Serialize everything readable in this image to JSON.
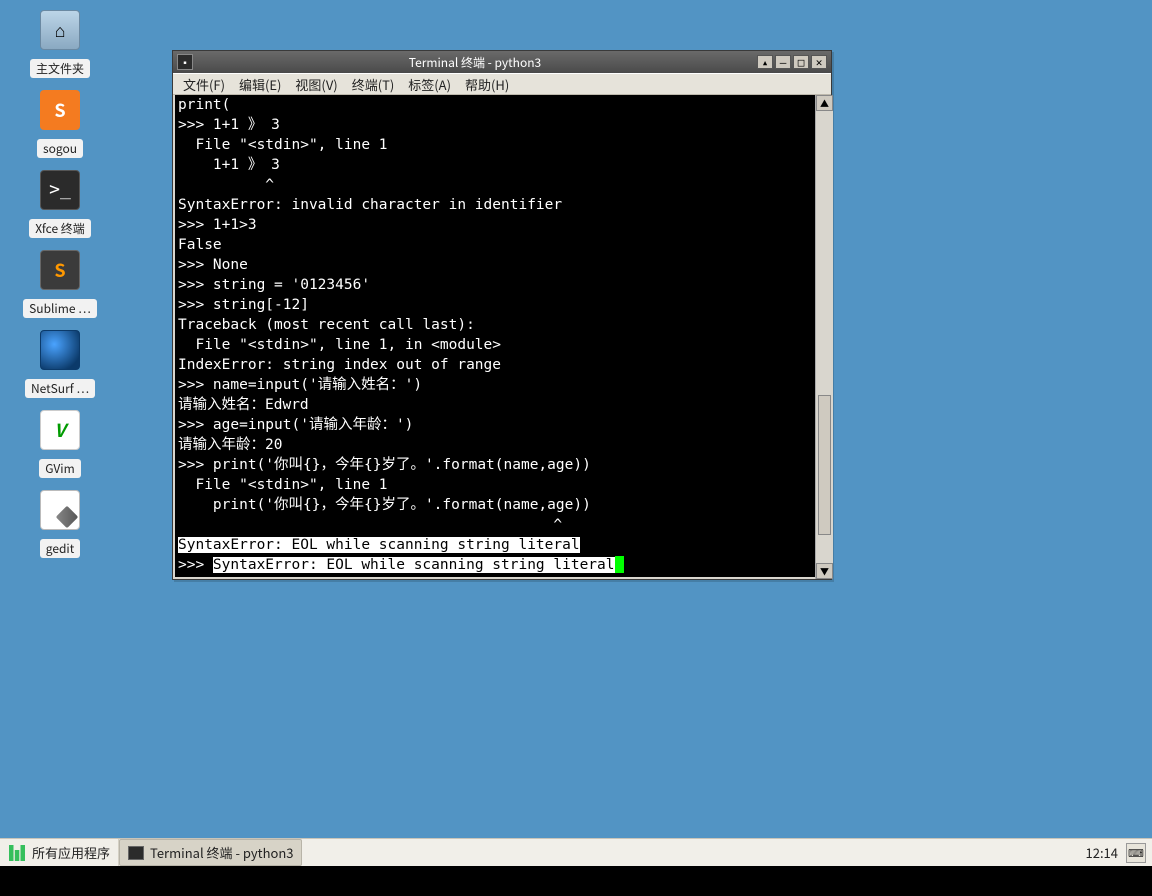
{
  "desktop_icons": [
    {
      "id": "home-folder",
      "label": "主文件夹",
      "glyph": "⌂"
    },
    {
      "id": "sogou",
      "label": "sogou",
      "glyph": "S"
    },
    {
      "id": "xfce-terminal",
      "label": "Xfce 终端",
      "glyph": ">_"
    },
    {
      "id": "sublime",
      "label": "Sublime …",
      "glyph": "S"
    },
    {
      "id": "netsurf",
      "label": "NetSurf …",
      "glyph": ""
    },
    {
      "id": "gvim",
      "label": "GVim",
      "glyph": "V"
    },
    {
      "id": "gedit",
      "label": "gedit",
      "glyph": ""
    }
  ],
  "window": {
    "title": "Terminal 终端 - python3",
    "menus": {
      "file": "文件(F)",
      "edit": "编辑(E)",
      "view": "视图(V)",
      "terminal": "终端(T)",
      "tabs": "标签(A)",
      "help": "帮助(H)"
    },
    "terminal_lines": [
      {
        "t": "print("
      },
      {
        "t": ">>> 1+1 》 3"
      },
      {
        "t": "  File \"<stdin>\", line 1"
      },
      {
        "t": "    1+1 》 3"
      },
      {
        "t": "          ^"
      },
      {
        "t": "SyntaxError: invalid character in identifier"
      },
      {
        "t": ">>> 1+1>3"
      },
      {
        "t": "False"
      },
      {
        "t": ">>> None"
      },
      {
        "t": ">>> string = '0123456'"
      },
      {
        "t": ">>> string[-12]"
      },
      {
        "t": "Traceback (most recent call last):"
      },
      {
        "t": "  File \"<stdin>\", line 1, in <module>"
      },
      {
        "t": "IndexError: string index out of range"
      },
      {
        "t": ">>> name=input('请输入姓名：')"
      },
      {
        "t": "请输入姓名：Edwrd"
      },
      {
        "t": ">>> age=input('请输入年龄：')"
      },
      {
        "t": "请输入年龄：20"
      },
      {
        "t": ">>> print('你叫{}，今年{}岁了。'.format(name,age))"
      },
      {
        "t": "  File \"<stdin>\", line 1"
      },
      {
        "t": "    print('你叫{}，今年{}岁了。'.format(name,age))"
      },
      {
        "t": "                                           ^"
      },
      {
        "t": "SyntaxError: EOL while scanning string literal",
        "hl": true
      },
      {
        "t": ">>> ",
        "tail": "SyntaxError: EOL while scanning string literal",
        "tail_hl": true,
        "cursor": true
      }
    ]
  },
  "taskbar": {
    "all_apps": "所有应用程序",
    "active_task": "Terminal 终端 - python3",
    "clock": "12:14"
  }
}
